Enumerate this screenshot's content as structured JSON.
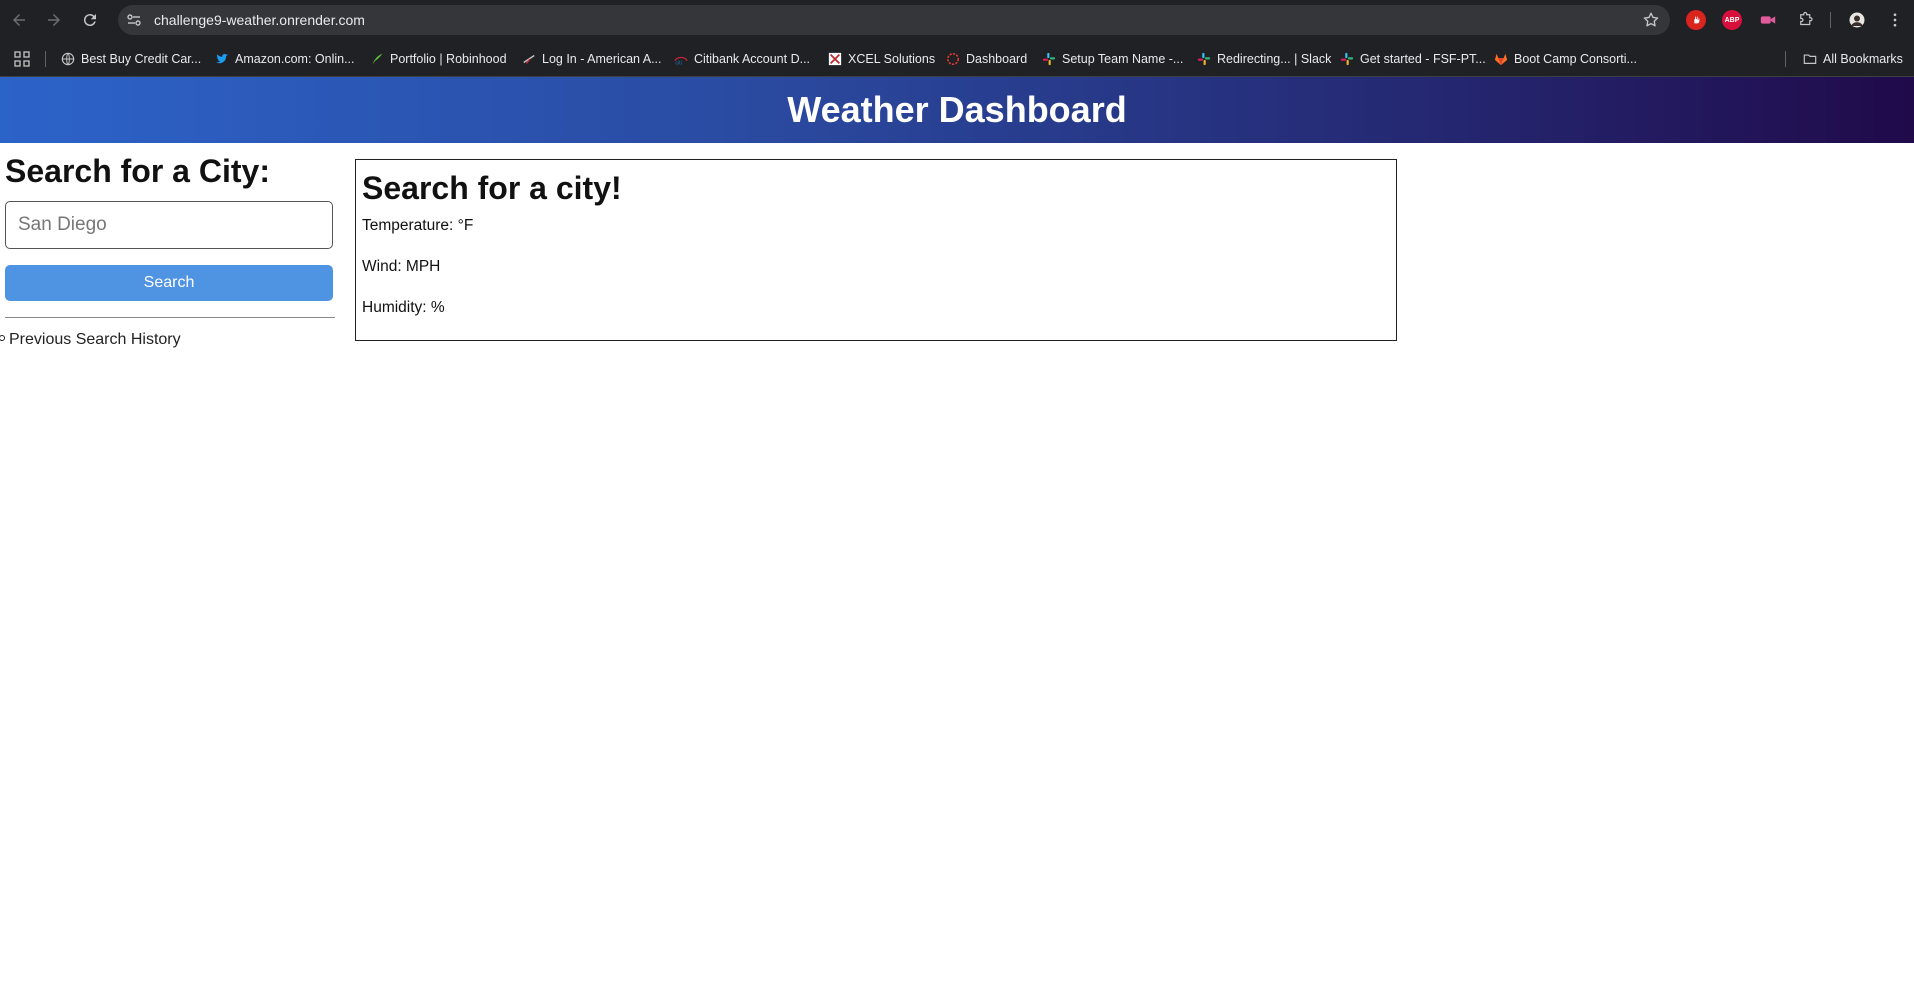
{
  "browser": {
    "url": "challenge9-weather.onrender.com",
    "bookmarks": [
      {
        "label": "Best Buy Credit Car...",
        "icon": "globe-icon"
      },
      {
        "label": "Amazon.com: Onlin...",
        "icon": "twitter-bird-icon"
      },
      {
        "label": "Portfolio | Robinhood",
        "icon": "robinhood-feather-icon"
      },
      {
        "label": "Log In - American A...",
        "icon": "american-airlines-icon"
      },
      {
        "label": "Citibank Account D...",
        "icon": "citi-icon"
      },
      {
        "label": "XCEL Solutions",
        "icon": "xcel-icon"
      },
      {
        "label": "Dashboard",
        "icon": "dashboard-circle-icon"
      },
      {
        "label": "Setup Team Name -...",
        "icon": "slack-icon"
      },
      {
        "label": "Redirecting... | Slack",
        "icon": "slack-icon"
      },
      {
        "label": "Get started - FSF-PT...",
        "icon": "slack-icon"
      },
      {
        "label": "Boot Camp Consorti...",
        "icon": "gitlab-icon"
      }
    ],
    "all_bookmarks_label": "All Bookmarks",
    "extensions": [
      {
        "name": "hand-extension-icon",
        "color": "#d9251d"
      },
      {
        "name": "adblock-plus-icon",
        "color": "#d6103a",
        "text": "ABP"
      },
      {
        "name": "video-extension-icon",
        "color": "#c2185b"
      }
    ]
  },
  "page": {
    "header_title": "Weather Dashboard",
    "sidebar": {
      "title": "Search for a City:",
      "search_placeholder": "San Diego",
      "search_button": "Search",
      "history_label": "Previous Search History"
    },
    "card": {
      "title": "Search for a city!",
      "temperature": "Temperature: °F",
      "wind": "Wind: MPH",
      "humidity": "Humidity: %"
    },
    "colors": {
      "button": "#4f94e2",
      "header_gradient_start": "#2c63c9",
      "header_gradient_end": "#200a4a"
    }
  }
}
